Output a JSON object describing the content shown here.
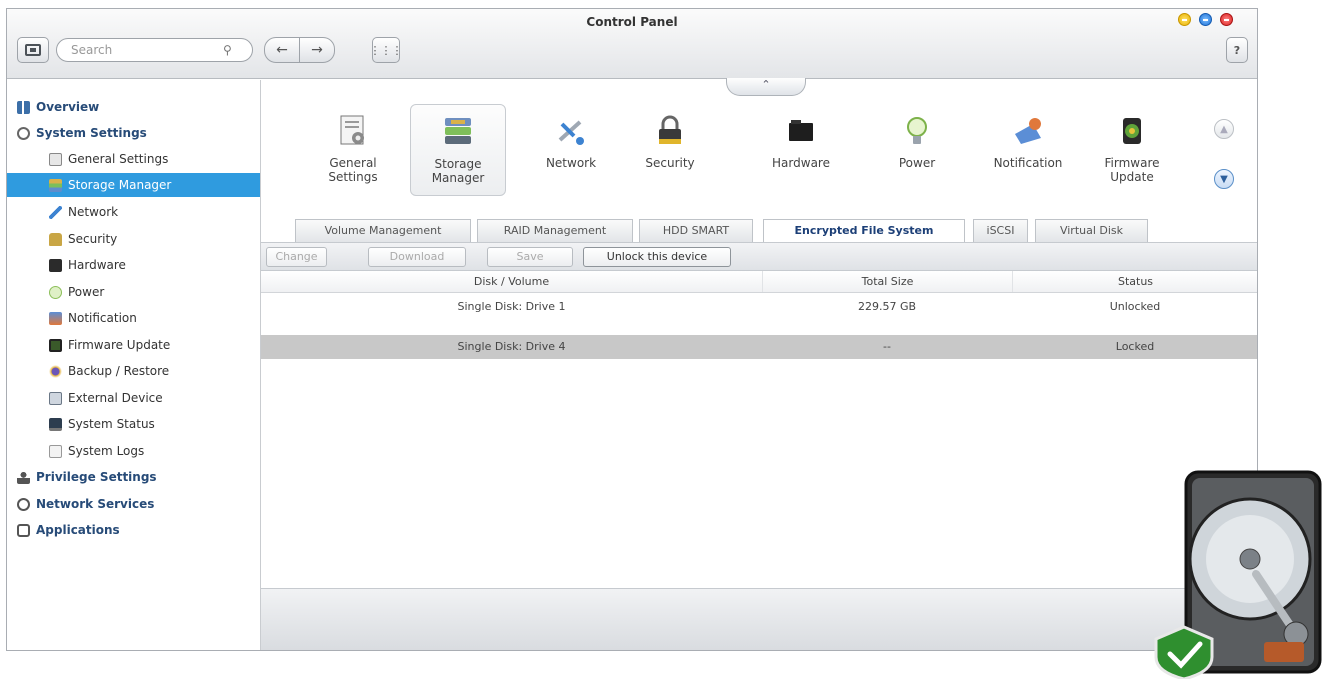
{
  "window": {
    "title": "Control Panel",
    "search_placeholder": "Search",
    "help_label": "?"
  },
  "sidebar": {
    "items": [
      {
        "label": "Overview",
        "icon": "overview-icon",
        "level": "top"
      },
      {
        "label": "System Settings",
        "icon": "gear-icon",
        "level": "top"
      },
      {
        "label": "General Settings",
        "icon": "general-settings-icon",
        "level": "sub"
      },
      {
        "label": "Storage Manager",
        "icon": "storage-manager-icon",
        "level": "sub",
        "active": true
      },
      {
        "label": "Network",
        "icon": "network-icon",
        "level": "sub"
      },
      {
        "label": "Security",
        "icon": "lock-icon",
        "level": "sub"
      },
      {
        "label": "Hardware",
        "icon": "hardware-icon",
        "level": "sub"
      },
      {
        "label": "Power",
        "icon": "power-bulb-icon",
        "level": "sub"
      },
      {
        "label": "Notification",
        "icon": "notification-icon",
        "level": "sub"
      },
      {
        "label": "Firmware Update",
        "icon": "firmware-update-icon",
        "level": "sub"
      },
      {
        "label": "Backup / Restore",
        "icon": "backup-restore-icon",
        "level": "sub"
      },
      {
        "label": "External Device",
        "icon": "external-device-icon",
        "level": "sub"
      },
      {
        "label": "System Status",
        "icon": "system-status-icon",
        "level": "sub"
      },
      {
        "label": "System Logs",
        "icon": "system-logs-icon",
        "level": "sub"
      },
      {
        "label": "Privilege Settings",
        "icon": "user-icon",
        "level": "top"
      },
      {
        "label": "Network Services",
        "icon": "globe-icon",
        "level": "top"
      },
      {
        "label": "Applications",
        "icon": "applications-icon",
        "level": "top"
      }
    ]
  },
  "iconbar": {
    "items": [
      {
        "label1": "General",
        "label2": "Settings",
        "icon": "general-settings-icon"
      },
      {
        "label1": "Storage",
        "label2": "Manager",
        "icon": "storage-manager-icon",
        "selected": true
      },
      {
        "label1": "Network",
        "label2": "",
        "icon": "network-icon"
      },
      {
        "label1": "Security",
        "label2": "",
        "icon": "lock-icon"
      },
      {
        "label1": "Hardware",
        "label2": "",
        "icon": "hardware-icon"
      },
      {
        "label1": "Power",
        "label2": "",
        "icon": "power-bulb-icon"
      },
      {
        "label1": "Notification",
        "label2": "",
        "icon": "notification-icon"
      },
      {
        "label1": "Firmware",
        "label2": "Update",
        "icon": "firmware-update-icon"
      }
    ]
  },
  "tabs": [
    {
      "label": "Volume Management"
    },
    {
      "label": "RAID Management"
    },
    {
      "label": "HDD SMART"
    },
    {
      "label": "Encrypted File System",
      "active": true
    },
    {
      "label": "iSCSI"
    },
    {
      "label": "Virtual Disk"
    }
  ],
  "actions": {
    "change": "Change",
    "download": "Download",
    "save": "Save",
    "unlock": "Unlock this device"
  },
  "table": {
    "columns": [
      "Disk / Volume",
      "Total Size",
      "Status"
    ],
    "rows": [
      {
        "disk": "Single Disk: Drive 1",
        "size": "229.57 GB",
        "status": "Unlocked"
      },
      {
        "disk": "Single Disk: Drive 4",
        "size": "--",
        "status": "Locked"
      }
    ]
  },
  "colors": {
    "accent": "#2f9bdf",
    "selected_row": "#c8c8c8",
    "active_tab_text": "#1c3f77"
  }
}
